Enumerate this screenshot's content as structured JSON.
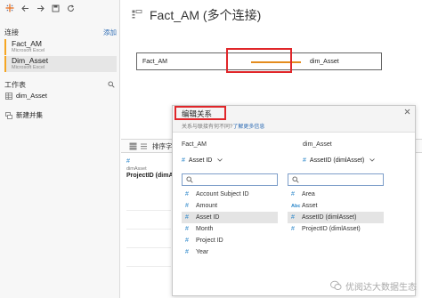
{
  "toolbar": {
    "icons": [
      "tableau-logo-icon",
      "back-arrow-icon",
      "forward-arrow-icon",
      "save-icon",
      "refresh-icon"
    ]
  },
  "connections": {
    "title": "连接",
    "add_label": "添加",
    "items": [
      {
        "name": "Fact_AM",
        "type": "Microsoft Excel",
        "selected": false
      },
      {
        "name": "Dim_Asset",
        "type": "Microsoft Excel",
        "selected": true
      }
    ]
  },
  "sheets": {
    "title": "工作表",
    "items": [
      {
        "name": "dim_Asset",
        "icon": "table-icon"
      }
    ],
    "new_union_label": "新建并集"
  },
  "main": {
    "datasource_title": "Fact_AM (多个连接)",
    "join_left": "Fact_AM",
    "join_right": "dim_Asset",
    "grid": {
      "sort_label": "排序字段",
      "column_type_symbol": "#",
      "column_table": "dimAsset",
      "column_field": "ProjectID (dimA..."
    }
  },
  "dialog": {
    "title": "编辑关系",
    "subtitle_text": "关系与联接有何不同?",
    "subtitle_link": "了解更多信息",
    "left": {
      "table_label": "Fact_AM",
      "selected_field": "Asset ID",
      "search_placeholder": "",
      "fields": [
        {
          "name": "Account Subject ID",
          "kind": "#",
          "selected": false
        },
        {
          "name": "Amount",
          "kind": "#",
          "selected": false
        },
        {
          "name": "Asset ID",
          "kind": "#",
          "selected": true
        },
        {
          "name": "Month",
          "kind": "#",
          "selected": false
        },
        {
          "name": "Project ID",
          "kind": "#",
          "selected": false
        },
        {
          "name": "Year",
          "kind": "#",
          "selected": false
        }
      ]
    },
    "right": {
      "table_label": "dim_Asset",
      "selected_field": "AssetID (dimlAsset)",
      "search_placeholder": "",
      "fields": [
        {
          "name": "Area",
          "kind": "#",
          "selected": false
        },
        {
          "name": "Asset",
          "kind": "Abc",
          "selected": false
        },
        {
          "name": "AssetID (dimlAsset)",
          "kind": "#",
          "selected": true
        },
        {
          "name": "ProjectID (dimlAsset)",
          "kind": "#",
          "selected": false
        }
      ]
    }
  },
  "watermark": "优阅达大数据生态",
  "colors": {
    "accent_orange": "#f5a623",
    "join_line": "#e48c1e",
    "highlight_red": "#e0262a",
    "link_blue": "#2f6db5",
    "field_blue": "#2b86c9"
  }
}
